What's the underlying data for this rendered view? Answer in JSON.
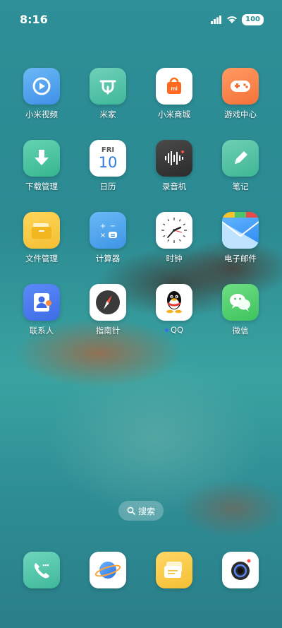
{
  "status_bar": {
    "time": "8:16",
    "battery": "100"
  },
  "apps": [
    {
      "label": "小米视频",
      "icon": "video-play-icon"
    },
    {
      "label": "米家",
      "icon": "mijia-icon"
    },
    {
      "label": "小米商城",
      "icon": "mi-store-bag-icon"
    },
    {
      "label": "游戏中心",
      "icon": "gamepad-icon"
    },
    {
      "label": "下载管理",
      "icon": "download-arrow-icon"
    },
    {
      "label": "日历",
      "icon": "calendar-icon",
      "day": "FRI",
      "date": "10"
    },
    {
      "label": "录音机",
      "icon": "waveform-icon"
    },
    {
      "label": "笔记",
      "icon": "pencil-icon"
    },
    {
      "label": "文件管理",
      "icon": "folder-icon"
    },
    {
      "label": "计算器",
      "icon": "calculator-icon"
    },
    {
      "label": "时钟",
      "icon": "clock-icon"
    },
    {
      "label": "电子邮件",
      "icon": "mail-icon"
    },
    {
      "label": "联系人",
      "icon": "contacts-icon"
    },
    {
      "label": "指南针",
      "icon": "compass-icon"
    },
    {
      "label": "QQ",
      "icon": "qq-penguin-icon"
    },
    {
      "label": "微信",
      "icon": "wechat-icon"
    }
  ],
  "search": {
    "label": "搜索"
  },
  "dock": [
    {
      "icon": "phone-icon"
    },
    {
      "icon": "browser-planet-icon"
    },
    {
      "icon": "messages-icon"
    },
    {
      "icon": "camera-icon"
    }
  ]
}
